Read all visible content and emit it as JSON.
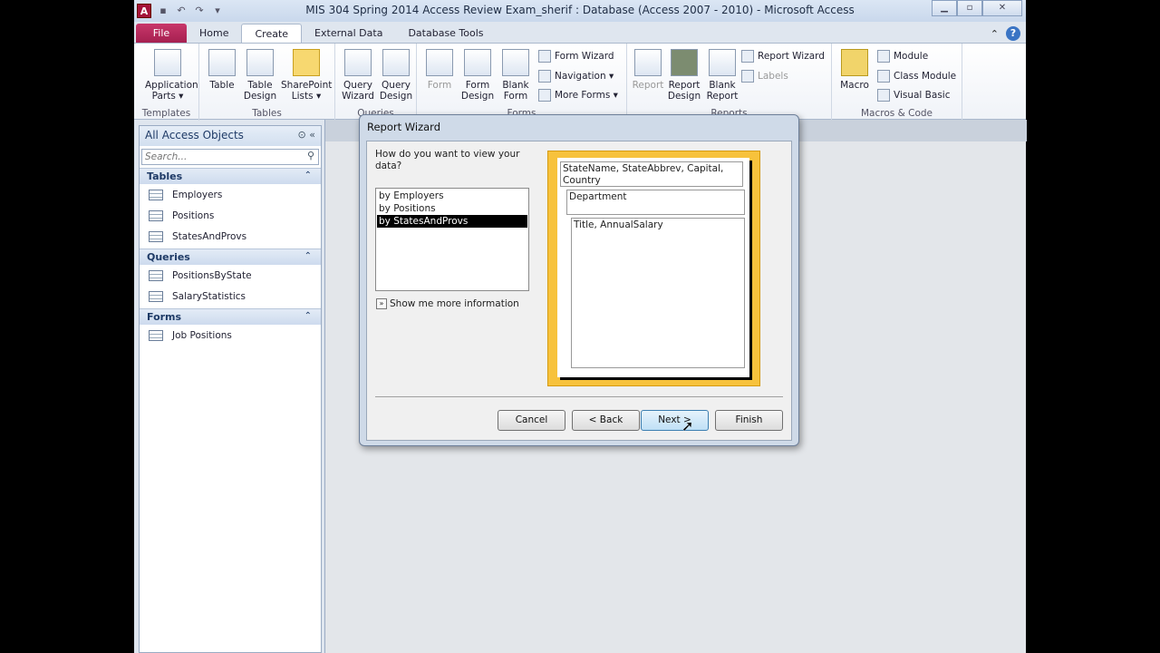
{
  "window": {
    "title": "MIS 304 Spring 2014 Access Review Exam_sherif : Database (Access 2007 - 2010)  -  Microsoft Access",
    "app_icon": "A"
  },
  "tabs": [
    {
      "label": "File"
    },
    {
      "label": "Home"
    },
    {
      "label": "Create",
      "active": true
    },
    {
      "label": "External Data"
    },
    {
      "label": "Database Tools"
    }
  ],
  "ribbon": {
    "templates": {
      "label": "Templates",
      "app_parts": "Application Parts ▾"
    },
    "tables": {
      "label": "Tables",
      "table": "Table",
      "table_design": "Table Design",
      "sharepoint": "SharePoint Lists ▾"
    },
    "queries": {
      "label": "Queries",
      "wizard": "Query Wizard",
      "design": "Query Design"
    },
    "forms": {
      "label": "Forms",
      "form": "Form",
      "form_design": "Form Design",
      "blank_form": "Blank Form",
      "form_wizard": "Form Wizard",
      "navigation": "Navigation ▾",
      "more_forms": "More Forms ▾"
    },
    "reports": {
      "label": "Reports",
      "report": "Report",
      "report_design": "Report Design",
      "blank_report": "Blank Report",
      "report_wizard": "Report Wizard",
      "labels": "Labels"
    },
    "macros": {
      "label": "Macros & Code",
      "macro": "Macro",
      "module": "Module",
      "class_module": "Class Module",
      "visual_basic": "Visual Basic"
    }
  },
  "nav": {
    "title": "All Access Objects",
    "search_placeholder": "Search...",
    "sections": [
      {
        "label": "Tables",
        "items": [
          "Employers",
          "Positions",
          "StatesAndProvs"
        ]
      },
      {
        "label": "Queries",
        "items": [
          "PositionsByState",
          "SalaryStatistics"
        ]
      },
      {
        "label": "Forms",
        "items": [
          "Job Positions"
        ]
      }
    ]
  },
  "dialog": {
    "title": "Report Wizard",
    "question": "How do you want to view your data?",
    "options": [
      "by Employers",
      "by Positions",
      "by StatesAndProvs"
    ],
    "selected": "by StatesAndProvs",
    "more_info": "Show me more information",
    "preview": {
      "level1": "StateName, StateAbbrev, Capital, Country",
      "level2": "Department",
      "detail": "Title, AnnualSalary"
    },
    "buttons": {
      "cancel": "Cancel",
      "back": "< Back",
      "next": "Next >",
      "finish": "Finish"
    },
    "accent": "#f7c23c"
  }
}
